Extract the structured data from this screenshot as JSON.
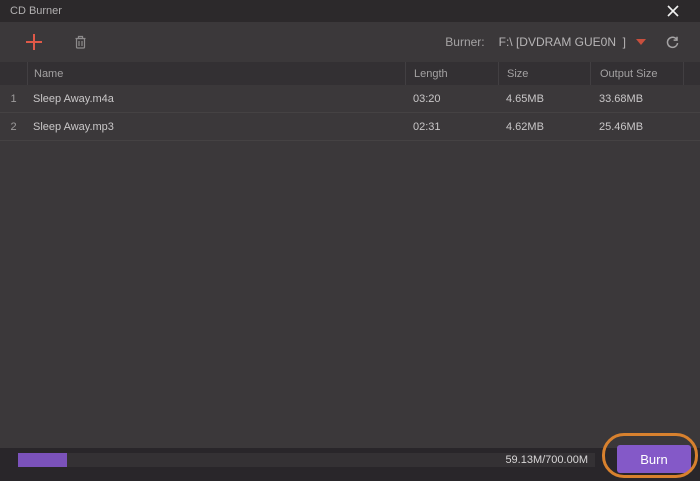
{
  "window": {
    "title": "CD Burner"
  },
  "toolbar": {
    "add_icon": "plus",
    "delete_icon": "trash",
    "burner_label": "Burner:",
    "burner_value": "F:\\ [DVDRAM GUE0N  ]",
    "refresh_icon": "refresh"
  },
  "table": {
    "columns": {
      "name": "Name",
      "length": "Length",
      "size": "Size",
      "output": "Output Size"
    },
    "rows": [
      {
        "num": "1",
        "name": "Sleep Away.m4a",
        "length": "03:20",
        "size": "4.65MB",
        "output": "33.68MB"
      },
      {
        "num": "2",
        "name": "Sleep Away.mp3",
        "length": "02:31",
        "size": "4.62MB",
        "output": "25.46MB"
      }
    ]
  },
  "footer": {
    "progress_percent": 8.45,
    "capacity_text": "59.13M/700.00M",
    "burn_label": "Burn"
  },
  "colors": {
    "accent_purple": "#7b52bb",
    "button_purple": "#8459c8",
    "annotation_orange": "#d8812e",
    "add_icon_red": "#e05948",
    "caret_red": "#c94f3d",
    "titlebar_bg": "#2c292b",
    "body_bg": "#3b383a",
    "header_bg": "#333033",
    "footer_bg": "#29262a"
  }
}
